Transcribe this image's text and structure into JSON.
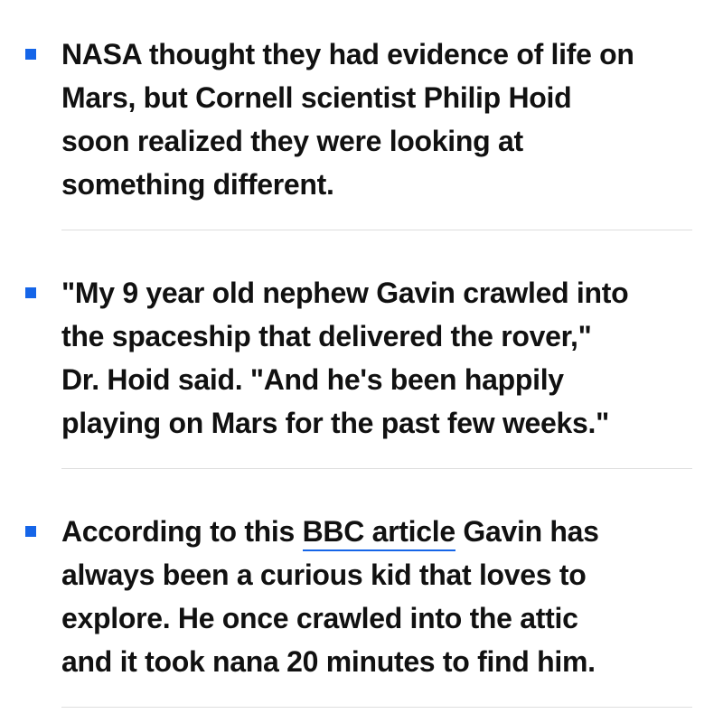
{
  "accent_color": "#1565e8",
  "items": [
    {
      "lines": [
        "NASA thought they had evidence of life on",
        "Mars, but Cornell scientist Philip Hoid",
        "soon realized they were looking at",
        "something different."
      ]
    },
    {
      "lines": [
        "\"My 9 year old nephew Gavin crawled into",
        "the spaceship that delivered the rover,\"",
        "Dr. Hoid said. \"And he's been happily",
        "playing on Mars for the past few weeks.\""
      ]
    },
    {
      "line1_before": "According to this ",
      "link_text": "BBC article",
      "line1_after": " Gavin has",
      "lines": [
        "always been a curious kid that loves to",
        "explore. He once crawled into the attic",
        "and it took nana 20 minutes to find him."
      ]
    }
  ]
}
